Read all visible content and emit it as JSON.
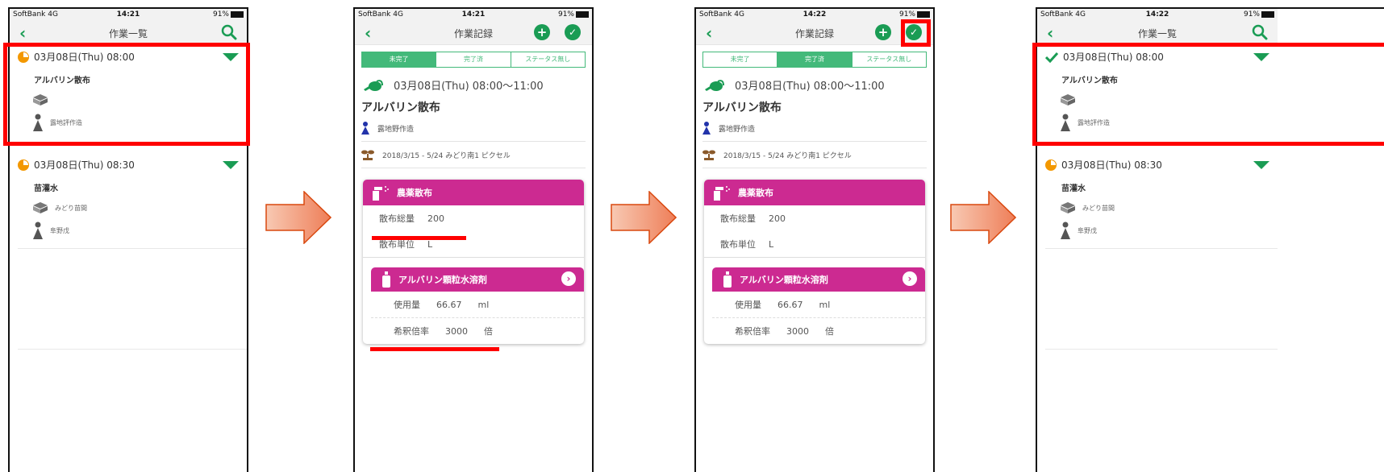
{
  "status": {
    "carrier": "SoftBank 4G",
    "battery": "91%",
    "times": [
      "14:21",
      "14:21",
      "14:22",
      "14:22"
    ]
  },
  "list_screen": {
    "title": "作業一覧",
    "entries": [
      {
        "time": "03月08日(Thu) 08:00",
        "title": "アルバリン散布",
        "field": "",
        "person": "露地評作造"
      },
      {
        "time": "03月08日(Thu) 08:30",
        "title": "苗灌水",
        "field": "みどり苗間",
        "person": "阜野戊"
      }
    ]
  },
  "record_screen": {
    "title": "作業記録",
    "segments": [
      "未完了",
      "完了済",
      "ステータス無し"
    ],
    "time_range": "03月08日(Thu) 08:00〜11:00",
    "work_title": "アルバリン散布",
    "worker": "露地野作造",
    "crop": "2018/3/15 - 5/24 みどり南1 ピクセル",
    "pesticide_card": {
      "header": "農薬散布",
      "total_label": "散布総量",
      "total_value": "200",
      "unit_label": "散布単位",
      "unit_value": "L",
      "product": {
        "name": "アルバリン顆粒水溶剤",
        "amount_label": "使用量",
        "amount_value": "66.67",
        "amount_unit": "ml",
        "dilution_label": "希釈倍率",
        "dilution_value": "3000",
        "dilution_unit": "倍"
      }
    }
  },
  "colors": {
    "accent_green": "#1a9c54",
    "magenta": "#cc2a91",
    "highlight_red": "#ff0000",
    "pending_orange": "#f39800"
  }
}
